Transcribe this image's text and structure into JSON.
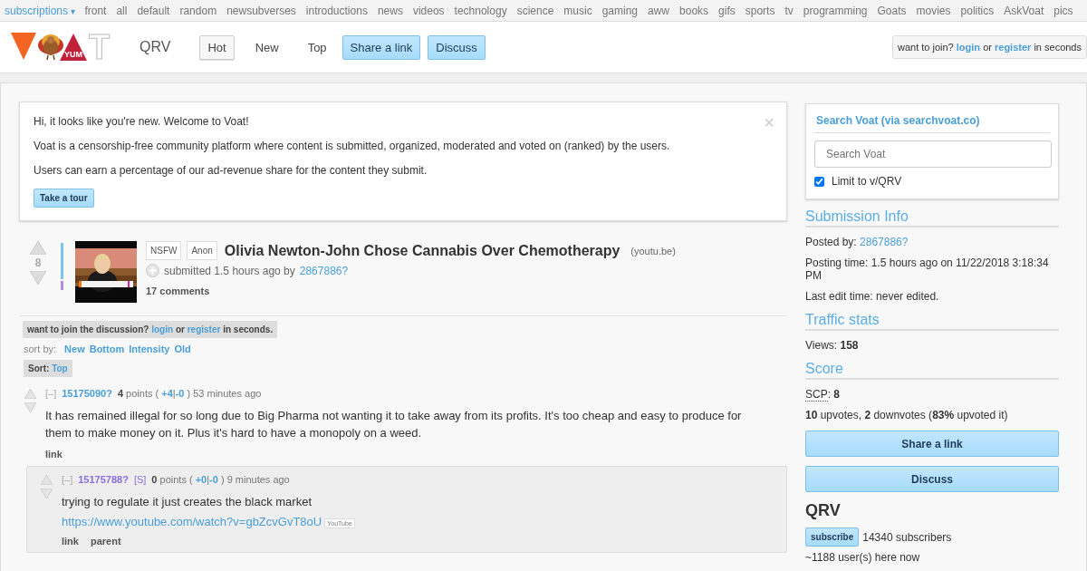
{
  "topnav": {
    "subscriptions": "subscriptions",
    "caret": "▾",
    "links": [
      "front",
      "all",
      "default",
      "random",
      "newsubverses",
      "introductions",
      "news",
      "videos",
      "technology",
      "science",
      "music",
      "gaming",
      "aww",
      "books",
      "gifs",
      "sports",
      "tv",
      "programming",
      "Goats",
      "movies",
      "politics",
      "AskVoat",
      "pics"
    ]
  },
  "header": {
    "logo": {
      "badge": "YUM",
      "letter": "T"
    },
    "subverse": "QRV",
    "tabs": [
      {
        "label": "Hot",
        "kind": "tab",
        "selected": true
      },
      {
        "label": "New",
        "kind": "tab",
        "selected": false
      },
      {
        "label": "Top",
        "kind": "tab",
        "selected": false
      },
      {
        "label": "Share a link",
        "kind": "button",
        "selected": false
      },
      {
        "label": "Discuss",
        "kind": "button",
        "selected": false
      }
    ],
    "join": {
      "prefix": "want to join?",
      "login": "login",
      "or": "or",
      "register": "register",
      "suffix": "in seconds"
    }
  },
  "welcome": {
    "lines": [
      "Hi, it looks like you're new. Welcome to Voat!",
      "Voat is a censorship-free community platform where content is submitted, organized, moderated and voted on (ranked) by the users.",
      "Users can earn a percentage of our ad-revenue share for the content they submit."
    ],
    "button": "Take a tour",
    "close": "×"
  },
  "post": {
    "score": "8",
    "thumbnail": {
      "kind": "picture"
    },
    "tags": [
      "NSFW",
      "Anon"
    ],
    "title": "Olivia Newton-John Chose Cannabis Over Chemotherapy",
    "domain": "(youtu.be)",
    "submitted": "submitted 1.5 hours ago by",
    "author": "2867886?",
    "comments": "17 comments"
  },
  "discussion": {
    "prefix": "want to join the discussion?",
    "login": "login",
    "or": "or",
    "register": "register",
    "suffix": "in seconds."
  },
  "sort": {
    "label": "sort by:",
    "options": [
      "New",
      "Bottom",
      "Intensity",
      "Old"
    ],
    "current_label": "Sort:",
    "current": "Top"
  },
  "comments": [
    {
      "collapse": "[–]",
      "author": "15175090?",
      "points": "4",
      "points_label": "points (",
      "up": "+4",
      "sep": "|",
      "down": "-0",
      "close": ")",
      "time": "53 minutes ago",
      "body": "It has remained illegal for so long due to Big Pharma not wanting it to take away from its profits. It's too cheap and easy to produce for them to make money on it. Plus it's hard to have a monopoly on a weed.",
      "actions": [
        "link"
      ],
      "children": [
        {
          "collapse": "[–]",
          "author": "15175788?",
          "submitter_tag": "[S]",
          "points": "0",
          "points_label": "points (",
          "up": "+0",
          "sep": "|",
          "down": "-0",
          "close": ")",
          "time": "9 minutes ago",
          "body": "trying to regulate it just creates the black market",
          "url": "https://www.youtube.com/watch?v=gbZcvGvT8oU",
          "url_tag": "YouTube",
          "actions": [
            "link",
            "parent"
          ]
        }
      ]
    }
  ],
  "sidebar": {
    "search": {
      "title": "Search Voat (via searchvoat.co)",
      "placeholder": "Search Voat",
      "limit": {
        "label": "Limit to v/QRV",
        "checked": true
      }
    },
    "sections": [
      {
        "heading": "Submission Info",
        "lines": [
          {
            "text": "Posted by:",
            "link": "2867886?"
          },
          {
            "text": "Posting time: 1.5 hours ago on 11/22/2018 3:18:34 PM"
          },
          {
            "text": "Last edit time: never edited."
          }
        ]
      },
      {
        "heading": "Traffic stats",
        "lines": [
          {
            "text": "Views: **158**"
          }
        ]
      },
      {
        "heading": "Score",
        "lines": [
          {
            "abbr": "SCP",
            "text": ": **8**"
          },
          {
            "text": "**10** upvotes, **2** downvotes (**83%** upvoted it)"
          }
        ]
      }
    ],
    "buttons": [
      "Share a link",
      "Discuss"
    ],
    "subverse": {
      "name": "QRV",
      "subscribe": "subscribe",
      "subscribers": "14340 subscribers",
      "online": "~1188 user(s) here now"
    }
  }
}
